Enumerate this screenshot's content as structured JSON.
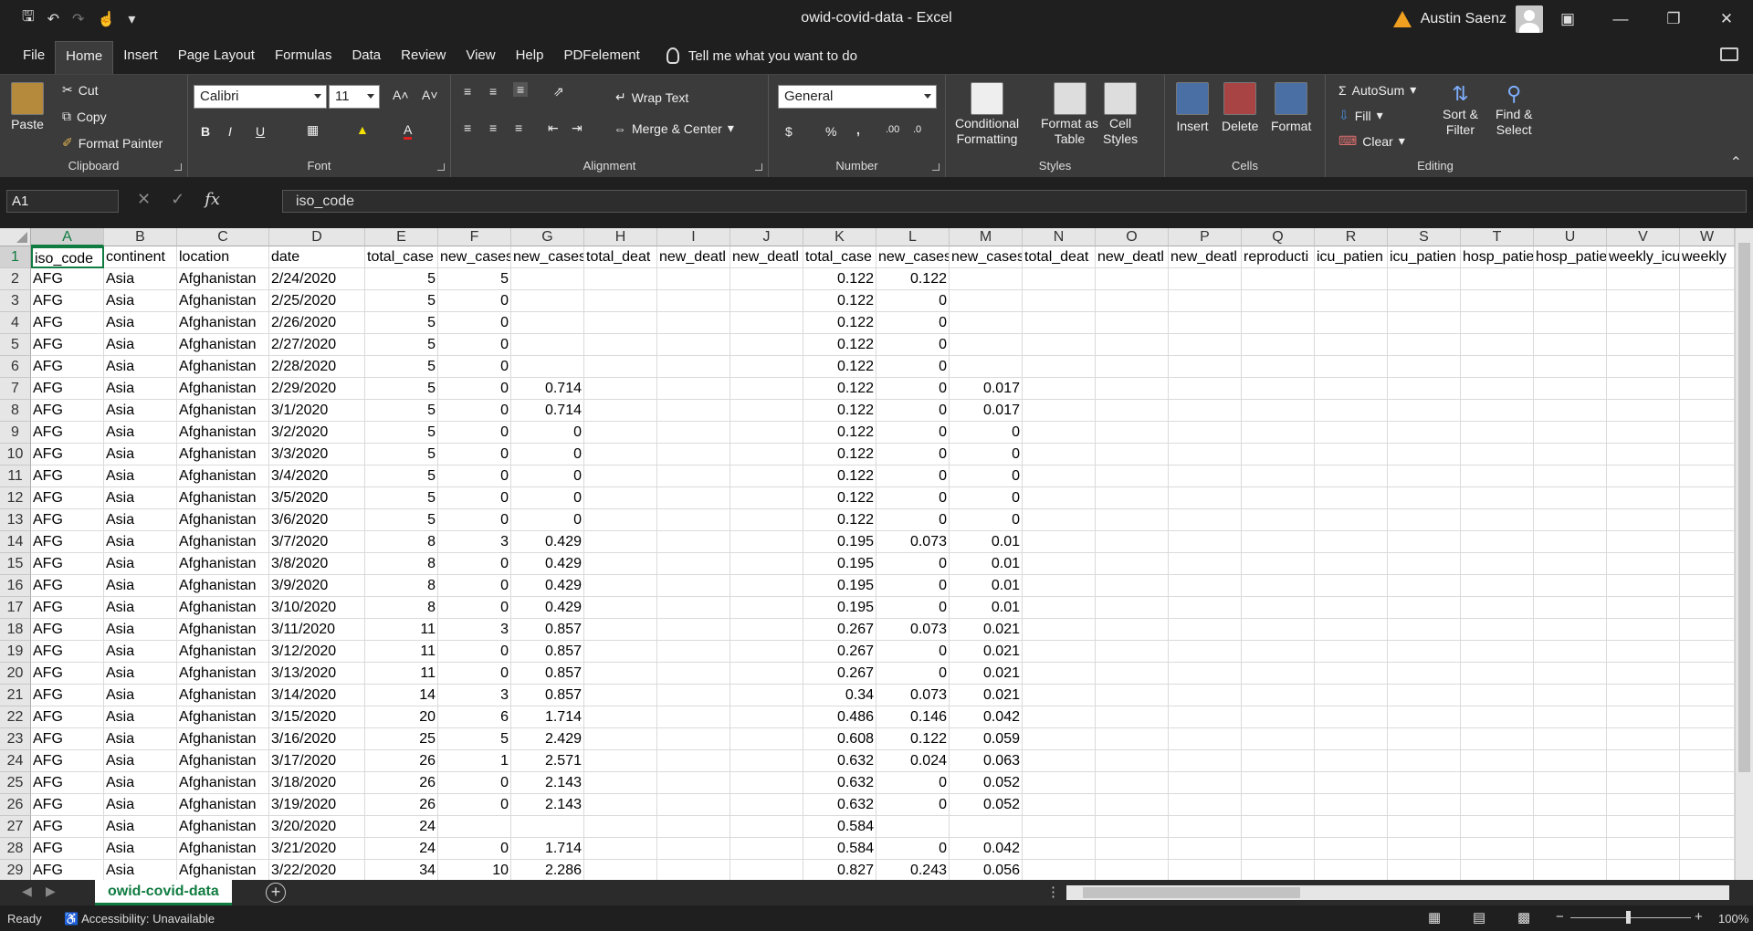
{
  "window": {
    "title": "owid-covid-data  -  Excel",
    "user": "Austin Saenz"
  },
  "quick_access": [
    "save-icon",
    "undo-icon",
    "redo-icon",
    "touch-mode-icon",
    "customize-icon"
  ],
  "menu": [
    "File",
    "Home",
    "Insert",
    "Page Layout",
    "Formulas",
    "Data",
    "Review",
    "View",
    "Help",
    "PDFelement"
  ],
  "tell_me": "Tell me what you want to do",
  "ribbon": {
    "clipboard": {
      "label": "Clipboard",
      "paste": "Paste",
      "cut": "Cut",
      "copy": "Copy",
      "format_painter": "Format Painter"
    },
    "font": {
      "label": "Font",
      "family": "Calibri",
      "size": "11",
      "bold": "B",
      "italic": "I",
      "underline": "U",
      "grow": "A˄",
      "shrink": "A˅",
      "color_a": "A"
    },
    "alignment": {
      "label": "Alignment",
      "wrap": "Wrap Text",
      "merge": "Merge & Center"
    },
    "number": {
      "label": "Number",
      "format": "General",
      "currency": "$",
      "percent": "%",
      "comma": ","
    },
    "styles": {
      "label": "Styles",
      "conditional": "Conditional",
      "conditional2": "Formatting",
      "format_table": "Format as",
      "format_table2": "Table",
      "cell_styles": "Cell",
      "cell_styles2": "Styles"
    },
    "cells": {
      "label": "Cells",
      "insert": "Insert",
      "delete": "Delete",
      "format": "Format"
    },
    "editing": {
      "label": "Editing",
      "autosum": "AutoSum",
      "fill": "Fill",
      "clear": "Clear",
      "sort": "Sort &",
      "sort2": "Filter",
      "find": "Find &",
      "find2": "Select"
    }
  },
  "formula_bar": {
    "name_box": "A1",
    "content": "iso_code",
    "fx": "fx",
    "cancel": "✕",
    "enter": "✓"
  },
  "columns": [
    "A",
    "B",
    "C",
    "D",
    "E",
    "F",
    "G",
    "H",
    "I",
    "J",
    "K",
    "L",
    "M",
    "N",
    "O",
    "P",
    "Q",
    "R",
    "S",
    "T",
    "U",
    "V",
    "W"
  ],
  "header_row": [
    "iso_code",
    "continent",
    "location",
    "date",
    "total_case",
    "new_cases",
    "new_cases",
    "total_deat",
    "new_deatl",
    "new_deatl",
    "total_case",
    "new_cases",
    "new_cases",
    "total_deat",
    "new_deatl",
    "new_deatl",
    "reproducti",
    "icu_patien",
    "icu_patien",
    "hosp_patie",
    "hosp_patie",
    "weekly_icu",
    "weekly"
  ],
  "rows": [
    [
      "AFG",
      "Asia",
      "Afghanistan",
      "2/24/2020",
      "5",
      "5",
      "",
      "",
      "",
      "",
      "0.122",
      "0.122",
      ""
    ],
    [
      "AFG",
      "Asia",
      "Afghanistan",
      "2/25/2020",
      "5",
      "0",
      "",
      "",
      "",
      "",
      "0.122",
      "0",
      ""
    ],
    [
      "AFG",
      "Asia",
      "Afghanistan",
      "2/26/2020",
      "5",
      "0",
      "",
      "",
      "",
      "",
      "0.122",
      "0",
      ""
    ],
    [
      "AFG",
      "Asia",
      "Afghanistan",
      "2/27/2020",
      "5",
      "0",
      "",
      "",
      "",
      "",
      "0.122",
      "0",
      ""
    ],
    [
      "AFG",
      "Asia",
      "Afghanistan",
      "2/28/2020",
      "5",
      "0",
      "",
      "",
      "",
      "",
      "0.122",
      "0",
      ""
    ],
    [
      "AFG",
      "Asia",
      "Afghanistan",
      "2/29/2020",
      "5",
      "0",
      "0.714",
      "",
      "",
      "",
      "0.122",
      "0",
      "0.017"
    ],
    [
      "AFG",
      "Asia",
      "Afghanistan",
      "3/1/2020",
      "5",
      "0",
      "0.714",
      "",
      "",
      "",
      "0.122",
      "0",
      "0.017"
    ],
    [
      "AFG",
      "Asia",
      "Afghanistan",
      "3/2/2020",
      "5",
      "0",
      "0",
      "",
      "",
      "",
      "0.122",
      "0",
      "0"
    ],
    [
      "AFG",
      "Asia",
      "Afghanistan",
      "3/3/2020",
      "5",
      "0",
      "0",
      "",
      "",
      "",
      "0.122",
      "0",
      "0"
    ],
    [
      "AFG",
      "Asia",
      "Afghanistan",
      "3/4/2020",
      "5",
      "0",
      "0",
      "",
      "",
      "",
      "0.122",
      "0",
      "0"
    ],
    [
      "AFG",
      "Asia",
      "Afghanistan",
      "3/5/2020",
      "5",
      "0",
      "0",
      "",
      "",
      "",
      "0.122",
      "0",
      "0"
    ],
    [
      "AFG",
      "Asia",
      "Afghanistan",
      "3/6/2020",
      "5",
      "0",
      "0",
      "",
      "",
      "",
      "0.122",
      "0",
      "0"
    ],
    [
      "AFG",
      "Asia",
      "Afghanistan",
      "3/7/2020",
      "8",
      "3",
      "0.429",
      "",
      "",
      "",
      "0.195",
      "0.073",
      "0.01"
    ],
    [
      "AFG",
      "Asia",
      "Afghanistan",
      "3/8/2020",
      "8",
      "0",
      "0.429",
      "",
      "",
      "",
      "0.195",
      "0",
      "0.01"
    ],
    [
      "AFG",
      "Asia",
      "Afghanistan",
      "3/9/2020",
      "8",
      "0",
      "0.429",
      "",
      "",
      "",
      "0.195",
      "0",
      "0.01"
    ],
    [
      "AFG",
      "Asia",
      "Afghanistan",
      "3/10/2020",
      "8",
      "0",
      "0.429",
      "",
      "",
      "",
      "0.195",
      "0",
      "0.01"
    ],
    [
      "AFG",
      "Asia",
      "Afghanistan",
      "3/11/2020",
      "11",
      "3",
      "0.857",
      "",
      "",
      "",
      "0.267",
      "0.073",
      "0.021"
    ],
    [
      "AFG",
      "Asia",
      "Afghanistan",
      "3/12/2020",
      "11",
      "0",
      "0.857",
      "",
      "",
      "",
      "0.267",
      "0",
      "0.021"
    ],
    [
      "AFG",
      "Asia",
      "Afghanistan",
      "3/13/2020",
      "11",
      "0",
      "0.857",
      "",
      "",
      "",
      "0.267",
      "0",
      "0.021"
    ],
    [
      "AFG",
      "Asia",
      "Afghanistan",
      "3/14/2020",
      "14",
      "3",
      "0.857",
      "",
      "",
      "",
      "0.34",
      "0.073",
      "0.021"
    ],
    [
      "AFG",
      "Asia",
      "Afghanistan",
      "3/15/2020",
      "20",
      "6",
      "1.714",
      "",
      "",
      "",
      "0.486",
      "0.146",
      "0.042"
    ],
    [
      "AFG",
      "Asia",
      "Afghanistan",
      "3/16/2020",
      "25",
      "5",
      "2.429",
      "",
      "",
      "",
      "0.608",
      "0.122",
      "0.059"
    ],
    [
      "AFG",
      "Asia",
      "Afghanistan",
      "3/17/2020",
      "26",
      "1",
      "2.571",
      "",
      "",
      "",
      "0.632",
      "0.024",
      "0.063"
    ],
    [
      "AFG",
      "Asia",
      "Afghanistan",
      "3/18/2020",
      "26",
      "0",
      "2.143",
      "",
      "",
      "",
      "0.632",
      "0",
      "0.052"
    ],
    [
      "AFG",
      "Asia",
      "Afghanistan",
      "3/19/2020",
      "26",
      "0",
      "2.143",
      "",
      "",
      "",
      "0.632",
      "0",
      "0.052"
    ],
    [
      "AFG",
      "Asia",
      "Afghanistan",
      "3/20/2020",
      "24",
      "",
      "",
      "",
      "",
      "",
      "0.584",
      "",
      ""
    ],
    [
      "AFG",
      "Asia",
      "Afghanistan",
      "3/21/2020",
      "24",
      "0",
      "1.714",
      "",
      "",
      "",
      "0.584",
      "0",
      "0.042"
    ],
    [
      "AFG",
      "Asia",
      "Afghanistan",
      "3/22/2020",
      "34",
      "10",
      "2.286",
      "",
      "",
      "",
      "0.827",
      "0.243",
      "0.056"
    ]
  ],
  "sheet_tab": "owid-covid-data",
  "status": {
    "ready": "Ready",
    "accessibility": "Accessibility: Unavailable",
    "zoom": "100%"
  }
}
